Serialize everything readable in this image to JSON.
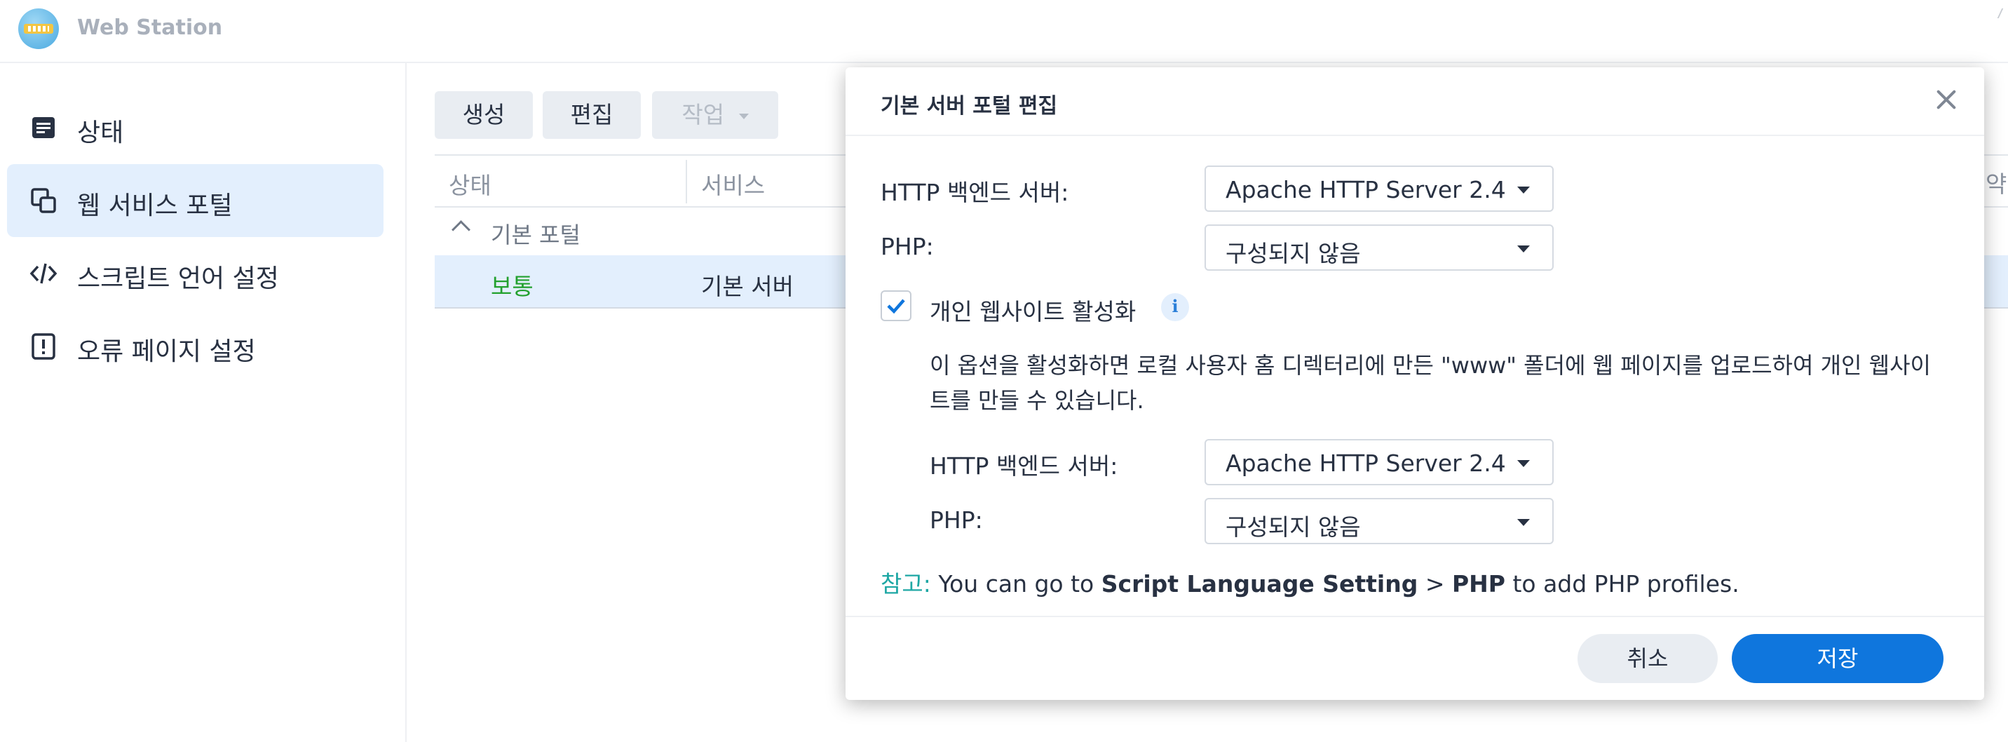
{
  "app": {
    "title": "Web Station"
  },
  "sidebar": {
    "items": [
      {
        "label": "상태",
        "icon": "status-icon",
        "active": false
      },
      {
        "label": "웹 서비스 포털",
        "icon": "portal-icon",
        "active": true
      },
      {
        "label": "스크립트 언어 설정",
        "icon": "code-icon",
        "active": false
      },
      {
        "label": "오류 페이지 설정",
        "icon": "error-page-icon",
        "active": false
      }
    ]
  },
  "toolbar": {
    "create": "생성",
    "edit": "편집",
    "action": "작업"
  },
  "grid": {
    "columns": [
      "상태",
      "서비스"
    ],
    "right_edge_text": "약",
    "group": "기본 포털",
    "rows": [
      {
        "status": "보통",
        "service": "기본 서버"
      }
    ]
  },
  "dialog": {
    "title": "기본 서버 포털 편집",
    "http_backend_label": "HTTP 백엔드 서버:",
    "http_backend_value": "Apache HTTP Server 2.4",
    "php_label": "PHP:",
    "php_value": "구성되지 않음",
    "personal_site_checkbox_label": "개인 웹사이트 활성화",
    "personal_site_checked": true,
    "description": "이 옵션을 활성화하면 로컬 사용자 홈 디렉터리에 만든 \"www\" 폴더에 웹 페이지를 업로드하여 개인 웹사이트를 만들 수 있습니다.",
    "personal_http_backend_label": "HTTP 백엔드 서버:",
    "personal_http_backend_value": "Apache HTTP Server 2.4",
    "personal_php_label": "PHP:",
    "personal_php_value": "구성되지 않음",
    "note": {
      "key": "참고:",
      "text1": " You can go to ",
      "bold1": "Script Language Setting",
      "sep": " > ",
      "bold2": "PHP",
      "text2": " to add PHP profiles."
    },
    "cancel": "취소",
    "save": "저장"
  },
  "colors": {
    "accent": "#0f76dd",
    "active_bg": "#e3effd",
    "ok_green": "#23a12f",
    "note_teal": "#1ea7a4"
  }
}
